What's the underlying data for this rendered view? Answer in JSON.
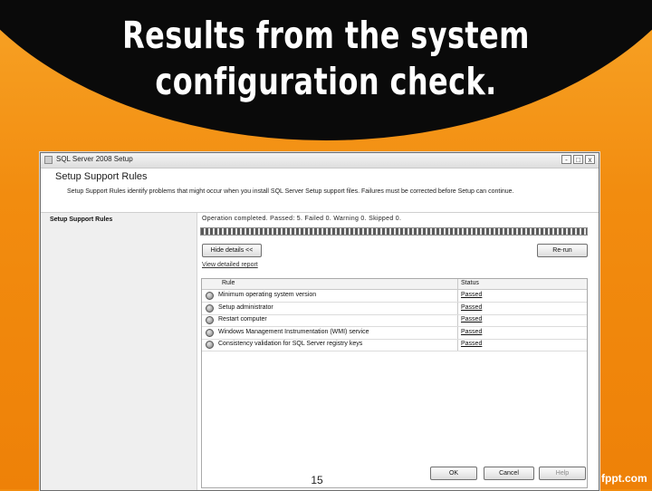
{
  "slide": {
    "title_line1": "Results from the system",
    "title_line2": "configuration check.",
    "page_number": "15",
    "brand": "fppt.com"
  },
  "window": {
    "title": "SQL Server 2008 Setup",
    "controls": [
      "-",
      "□",
      "x"
    ]
  },
  "header": {
    "title": "Setup Support Rules",
    "description": "Setup Support Rules identify problems that might occur when you install SQL Server Setup support files. Failures must be corrected before Setup can continue."
  },
  "nav": {
    "items": [
      {
        "label": "Setup Support Rules"
      }
    ]
  },
  "content": {
    "status": "Operation completed.  Passed: 5.    Failed 0.    Warning 0.    Skipped 0.",
    "hide_details_label": "Hide details <<",
    "rerun_label": "Re-run",
    "view_report_label": "View detailed report",
    "columns": [
      "Rule",
      "Status"
    ],
    "rows": [
      {
        "rule": "Minimum operating system version",
        "status": "Passed"
      },
      {
        "rule": "Setup administrator",
        "status": "Passed"
      },
      {
        "rule": "Restart computer",
        "status": "Passed"
      },
      {
        "rule": "Windows Management Instrumentation (WMI) service",
        "status": "Passed"
      },
      {
        "rule": "Consistency validation for SQL Server registry keys",
        "status": "Passed"
      }
    ]
  },
  "footer": {
    "ok_label": "OK",
    "cancel_label": "Cancel",
    "help_label": "Help"
  }
}
